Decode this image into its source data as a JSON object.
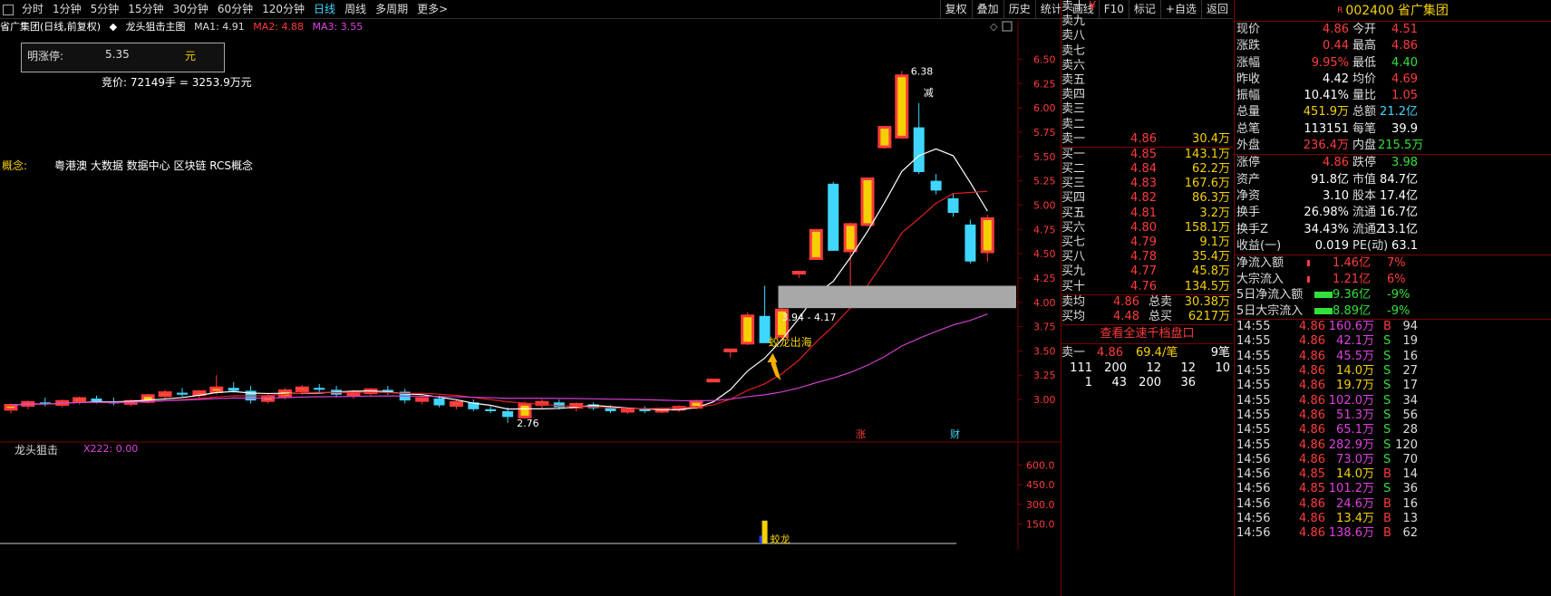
{
  "toolbar": {
    "periods": [
      "分时",
      "1分钟",
      "5分钟",
      "15分钟",
      "30分钟",
      "60分钟",
      "120分钟",
      "日线",
      "周线",
      "多周期",
      "更多>"
    ],
    "active": "日线",
    "buttons": [
      "复权",
      "叠加",
      "历史",
      "统计",
      "画线",
      "F10",
      "标记",
      "+自选",
      "返回"
    ]
  },
  "chart": {
    "stock_label": "省广集团(日线,前复权)",
    "main_name": "龙头狙击主图",
    "ma1": "MA1: 4.91",
    "ma2": "MA2: 4.88",
    "ma3": "MA3: 3.55",
    "limit_label": "明涨停:",
    "limit_value": "5.35",
    "limit_unit": "元",
    "auction": "竞价: 72149手 = 3253.9万元",
    "concept_label": "概念:",
    "concept_text": "粤港澳 大数据 数据中心 区块链 RCS概念",
    "high_label": "6.38",
    "low_label": "2.76",
    "range_label": "3.94 - 4.17",
    "signal_label": "蛟龙出海",
    "reduce_label": "减",
    "badge_zhang": "涨",
    "badge_cai": "财",
    "indicator_name": "龙头狙击",
    "indicator_value": "X222: 0.00",
    "bottom_signal": "蛟龙",
    "price_ticks": [
      "6.50",
      "6.25",
      "6.00",
      "5.75",
      "5.50",
      "5.25",
      "5.00",
      "4.75",
      "4.50",
      "4.25",
      "4.00",
      "3.75",
      "3.50",
      "3.25",
      "3.00"
    ],
    "ind_ticks": [
      "600.0",
      "450.0",
      "300.0",
      "150.0"
    ],
    "colors": {
      "up": "#ff3b3b",
      "down": "#3fd6ff",
      "ma1": "#ffffff",
      "ma2": "#e02020",
      "ma3": "#d040d0",
      "zone": "#a8a8a8"
    }
  },
  "chart_data": {
    "type": "candlestick",
    "y_range": [
      2.6,
      6.7
    ],
    "candles": [
      {
        "o": 2.9,
        "h": 2.96,
        "l": 2.86,
        "c": 2.94
      },
      {
        "o": 2.94,
        "h": 2.99,
        "l": 2.9,
        "c": 2.97
      },
      {
        "o": 2.97,
        "h": 3.02,
        "l": 2.93,
        "c": 2.95
      },
      {
        "o": 2.95,
        "h": 3.0,
        "l": 2.92,
        "c": 2.98
      },
      {
        "o": 2.98,
        "h": 3.03,
        "l": 2.95,
        "c": 3.01
      },
      {
        "o": 3.01,
        "h": 3.04,
        "l": 2.96,
        "c": 2.98
      },
      {
        "o": 2.98,
        "h": 3.02,
        "l": 2.94,
        "c": 2.96
      },
      {
        "o": 2.96,
        "h": 3.0,
        "l": 2.93,
        "c": 2.98
      },
      {
        "o": 2.98,
        "h": 3.06,
        "l": 2.96,
        "c": 3.04
      },
      {
        "o": 3.04,
        "h": 3.1,
        "l": 3.0,
        "c": 3.07
      },
      {
        "o": 3.07,
        "h": 3.12,
        "l": 3.03,
        "c": 3.05
      },
      {
        "o": 3.05,
        "h": 3.1,
        "l": 3.01,
        "c": 3.08
      },
      {
        "o": 3.08,
        "h": 3.25,
        "l": 3.05,
        "c": 3.12
      },
      {
        "o": 3.12,
        "h": 3.18,
        "l": 3.07,
        "c": 3.09
      },
      {
        "o": 3.09,
        "h": 3.14,
        "l": 2.96,
        "c": 2.99
      },
      {
        "o": 2.99,
        "h": 3.06,
        "l": 2.96,
        "c": 3.03
      },
      {
        "o": 3.03,
        "h": 3.12,
        "l": 3.0,
        "c": 3.09
      },
      {
        "o": 3.09,
        "h": 3.15,
        "l": 3.05,
        "c": 3.12
      },
      {
        "o": 3.12,
        "h": 3.16,
        "l": 3.07,
        "c": 3.1
      },
      {
        "o": 3.1,
        "h": 3.14,
        "l": 3.02,
        "c": 3.05
      },
      {
        "o": 3.05,
        "h": 3.1,
        "l": 3.01,
        "c": 3.07
      },
      {
        "o": 3.07,
        "h": 3.12,
        "l": 3.04,
        "c": 3.1
      },
      {
        "o": 3.1,
        "h": 3.14,
        "l": 3.05,
        "c": 3.08
      },
      {
        "o": 3.08,
        "h": 3.11,
        "l": 2.96,
        "c": 2.99
      },
      {
        "o": 2.99,
        "h": 3.03,
        "l": 2.95,
        "c": 3.01
      },
      {
        "o": 3.01,
        "h": 3.04,
        "l": 2.92,
        "c": 2.94
      },
      {
        "o": 2.94,
        "h": 3.0,
        "l": 2.9,
        "c": 2.97
      },
      {
        "o": 2.97,
        "h": 3.0,
        "l": 2.88,
        "c": 2.9
      },
      {
        "o": 2.9,
        "h": 2.93,
        "l": 2.86,
        "c": 2.88
      },
      {
        "o": 2.88,
        "h": 2.92,
        "l": 2.76,
        "c": 2.82
      },
      {
        "o": 2.82,
        "h": 2.98,
        "l": 2.8,
        "c": 2.95
      },
      {
        "o": 2.95,
        "h": 3.0,
        "l": 2.91,
        "c": 2.97
      },
      {
        "o": 2.97,
        "h": 3.0,
        "l": 2.9,
        "c": 2.92
      },
      {
        "o": 2.92,
        "h": 2.97,
        "l": 2.88,
        "c": 2.95
      },
      {
        "o": 2.95,
        "h": 2.97,
        "l": 2.89,
        "c": 2.91
      },
      {
        "o": 2.91,
        "h": 2.94,
        "l": 2.86,
        "c": 2.88
      },
      {
        "o": 2.88,
        "h": 2.92,
        "l": 2.85,
        "c": 2.9
      },
      {
        "o": 2.9,
        "h": 2.93,
        "l": 2.86,
        "c": 2.88
      },
      {
        "o": 2.88,
        "h": 2.92,
        "l": 2.86,
        "c": 2.9
      },
      {
        "o": 2.9,
        "h": 2.94,
        "l": 2.87,
        "c": 2.92
      },
      {
        "o": 2.92,
        "h": 3.0,
        "l": 2.9,
        "c": 2.98
      },
      {
        "o": 3.19,
        "h": 3.2,
        "l": 3.19,
        "c": 3.2
      },
      {
        "o": 3.5,
        "h": 3.51,
        "l": 3.43,
        "c": 3.51
      },
      {
        "o": 3.58,
        "h": 3.9,
        "l": 3.56,
        "c": 3.86
      },
      {
        "o": 3.86,
        "h": 4.17,
        "l": 3.58,
        "c": 3.58
      },
      {
        "o": 3.65,
        "h": 3.94,
        "l": 3.62,
        "c": 3.92
      },
      {
        "o": 4.3,
        "h": 4.31,
        "l": 4.25,
        "c": 4.31
      },
      {
        "o": 4.45,
        "h": 4.75,
        "l": 4.44,
        "c": 4.74
      },
      {
        "o": 5.22,
        "h": 5.24,
        "l": 4.53,
        "c": 4.53
      },
      {
        "o": 4.53,
        "h": 4.82,
        "l": 4.17,
        "c": 4.8
      },
      {
        "o": 4.8,
        "h": 5.28,
        "l": 4.78,
        "c": 5.27
      },
      {
        "o": 5.6,
        "h": 5.81,
        "l": 5.58,
        "c": 5.8
      },
      {
        "o": 5.7,
        "h": 6.38,
        "l": 5.68,
        "c": 6.33
      },
      {
        "o": 5.8,
        "h": 6.05,
        "l": 5.32,
        "c": 5.34
      },
      {
        "o": 5.25,
        "h": 5.32,
        "l": 5.11,
        "c": 5.15
      },
      {
        "o": 5.07,
        "h": 5.12,
        "l": 4.88,
        "c": 4.92
      },
      {
        "o": 4.8,
        "h": 4.85,
        "l": 4.4,
        "c": 4.42
      },
      {
        "o": 4.52,
        "h": 4.9,
        "l": 4.42,
        "c": 4.86
      }
    ]
  },
  "book": {
    "asks": [
      {
        "l": "卖十",
        "p": "¥",
        "v": ""
      },
      {
        "l": "卖九",
        "p": "",
        "v": ""
      },
      {
        "l": "卖八",
        "p": "",
        "v": ""
      },
      {
        "l": "卖七",
        "p": "",
        "v": ""
      },
      {
        "l": "卖六",
        "p": "",
        "v": ""
      },
      {
        "l": "卖五",
        "p": "",
        "v": ""
      },
      {
        "l": "卖四",
        "p": "",
        "v": ""
      },
      {
        "l": "卖三",
        "p": "",
        "v": ""
      },
      {
        "l": "卖二",
        "p": "",
        "v": ""
      },
      {
        "l": "卖一",
        "p": "4.86",
        "v": "30.4万"
      }
    ],
    "bids": [
      {
        "l": "买一",
        "p": "4.85",
        "v": "143.1万"
      },
      {
        "l": "买二",
        "p": "4.84",
        "v": "62.2万"
      },
      {
        "l": "买三",
        "p": "4.83",
        "v": "167.6万"
      },
      {
        "l": "买四",
        "p": "4.82",
        "v": "86.3万"
      },
      {
        "l": "买五",
        "p": "4.81",
        "v": "3.2万"
      },
      {
        "l": "买六",
        "p": "4.80",
        "v": "158.1万"
      },
      {
        "l": "买七",
        "p": "4.79",
        "v": "9.1万"
      },
      {
        "l": "买八",
        "p": "4.78",
        "v": "35.4万"
      },
      {
        "l": "买九",
        "p": "4.77",
        "v": "45.8万"
      },
      {
        "l": "买十",
        "p": "4.76",
        "v": "134.5万"
      }
    ],
    "avg_sell_label": "卖均",
    "avg_sell_price": "4.86",
    "total_sell_label": "总卖",
    "total_sell": "30.38万",
    "avg_buy_label": "买均",
    "avg_buy_price": "4.48",
    "total_buy_label": "总买",
    "total_buy": "6217万",
    "view_all": "查看全速千档盘口",
    "sell1_label": "卖一",
    "sell1_price": "4.86",
    "sell1_per": "69.4/笔",
    "sell1_count": "9笔",
    "queue1": [
      "111",
      "200",
      "12",
      "12",
      "10"
    ],
    "queue2": [
      "1",
      "43",
      "200",
      "36"
    ]
  },
  "quote": {
    "mark": "R",
    "code": "002400",
    "name": "省广集团",
    "rows": [
      {
        "l1": "现价",
        "v1": "4.86",
        "c1": "red",
        "l2": "今开",
        "v2": "4.51",
        "c2": "red"
      },
      {
        "l1": "涨跌",
        "v1": "0.44",
        "c1": "red",
        "l2": "最高",
        "v2": "4.86",
        "c2": "red"
      },
      {
        "l1": "涨幅",
        "v1": "9.95%",
        "c1": "red",
        "l2": "最低",
        "v2": "4.40",
        "c2": "green"
      },
      {
        "l1": "昨收",
        "v1": "4.42",
        "c1": "white",
        "l2": "均价",
        "v2": "4.69",
        "c2": "red"
      },
      {
        "l1": "振幅",
        "v1": "10.41%",
        "c1": "white",
        "l2": "量比",
        "v2": "1.05",
        "c2": "red"
      },
      {
        "l1": "总量",
        "v1": "451.9万",
        "c1": "yellow",
        "l2": "总额",
        "v2": "21.2亿",
        "c2": "cyan"
      },
      {
        "l1": "总笔",
        "v1": "113151",
        "c1": "white",
        "l2": "每笔",
        "v2": "39.9",
        "c2": "white"
      },
      {
        "l1": "外盘",
        "v1": "236.4万",
        "c1": "red",
        "l2": "内盘",
        "v2": "215.5万",
        "c2": "green"
      },
      {
        "l1": "涨停",
        "v1": "4.86",
        "c1": "red",
        "l2": "跌停",
        "v2": "3.98",
        "c2": "green"
      },
      {
        "l1": "资产",
        "v1": "91.8亿",
        "c1": "white",
        "l2": "市值",
        "v2": "84.7亿",
        "c2": "white"
      },
      {
        "l1": "净资",
        "v1": "3.10",
        "c1": "white",
        "l2": "股本",
        "v2": "17.4亿",
        "c2": "white"
      },
      {
        "l1": "换手",
        "v1": "26.98%",
        "c1": "white",
        "l2": "流通",
        "v2": "16.7亿",
        "c2": "white"
      },
      {
        "l1": "换手Z",
        "v1": "34.43%",
        "c1": "white",
        "l2": "流通Z",
        "v2": "13.1亿",
        "c2": "white"
      },
      {
        "l1": "收益(一)",
        "v1": "0.019",
        "c1": "white",
        "l2": "PE(动)",
        "v2": "63.1",
        "c2": "white"
      }
    ],
    "flows": [
      {
        "l": "净流入额",
        "v": "1.46亿",
        "p": "7%",
        "c": "red"
      },
      {
        "l": "大宗流入",
        "v": "1.21亿",
        "p": "6%",
        "c": "red"
      },
      {
        "l": "5日净流入额",
        "v": "-9.36亿",
        "p": "-9%",
        "c": "green"
      },
      {
        "l": "5日大宗流入",
        "v": "-8.89亿",
        "p": "-9%",
        "c": "green"
      }
    ],
    "ticks": [
      {
        "t": "14:55",
        "p": "4.86",
        "pc": "red",
        "v": "160.6万",
        "vc": "magenta",
        "bs": "B",
        "bc": "red",
        "n": "94"
      },
      {
        "t": "14:55",
        "p": "4.86",
        "pc": "red",
        "v": "42.1万",
        "vc": "magenta",
        "bs": "S",
        "bc": "green",
        "n": "19"
      },
      {
        "t": "14:55",
        "p": "4.86",
        "pc": "red",
        "v": "45.5万",
        "vc": "magenta",
        "bs": "S",
        "bc": "green",
        "n": "16"
      },
      {
        "t": "14:55",
        "p": "4.86",
        "pc": "red",
        "v": "14.0万",
        "vc": "yellow",
        "bs": "S",
        "bc": "green",
        "n": "27"
      },
      {
        "t": "14:55",
        "p": "4.86",
        "pc": "red",
        "v": "19.7万",
        "vc": "yellow",
        "bs": "S",
        "bc": "green",
        "n": "17"
      },
      {
        "t": "14:55",
        "p": "4.86",
        "pc": "red",
        "v": "102.0万",
        "vc": "magenta",
        "bs": "S",
        "bc": "green",
        "n": "34"
      },
      {
        "t": "14:55",
        "p": "4.86",
        "pc": "red",
        "v": "51.3万",
        "vc": "magenta",
        "bs": "S",
        "bc": "green",
        "n": "56"
      },
      {
        "t": "14:55",
        "p": "4.86",
        "pc": "red",
        "v": "65.1万",
        "vc": "magenta",
        "bs": "S",
        "bc": "green",
        "n": "28"
      },
      {
        "t": "14:55",
        "p": "4.86",
        "pc": "red",
        "v": "282.9万",
        "vc": "magenta",
        "bs": "S",
        "bc": "green",
        "n": "120"
      },
      {
        "t": "14:56",
        "p": "4.86",
        "pc": "red",
        "v": "73.0万",
        "vc": "magenta",
        "bs": "S",
        "bc": "green",
        "n": "70"
      },
      {
        "t": "14:56",
        "p": "4.85",
        "pc": "red",
        "v": "14.0万",
        "vc": "yellow",
        "bs": "B",
        "bc": "red",
        "n": "14"
      },
      {
        "t": "14:56",
        "p": "4.85",
        "pc": "red",
        "v": "101.2万",
        "vc": "magenta",
        "bs": "S",
        "bc": "green",
        "n": "36"
      },
      {
        "t": "14:56",
        "p": "4.86",
        "pc": "red",
        "v": "24.6万",
        "vc": "magenta",
        "bs": "B",
        "bc": "red",
        "n": "16"
      },
      {
        "t": "14:56",
        "p": "4.86",
        "pc": "red",
        "v": "13.4万",
        "vc": "yellow",
        "bs": "B",
        "bc": "red",
        "n": "13"
      },
      {
        "t": "14:56",
        "p": "4.86",
        "pc": "red",
        "v": "138.6万",
        "vc": "magenta",
        "bs": "B",
        "bc": "red",
        "n": "62"
      }
    ]
  }
}
